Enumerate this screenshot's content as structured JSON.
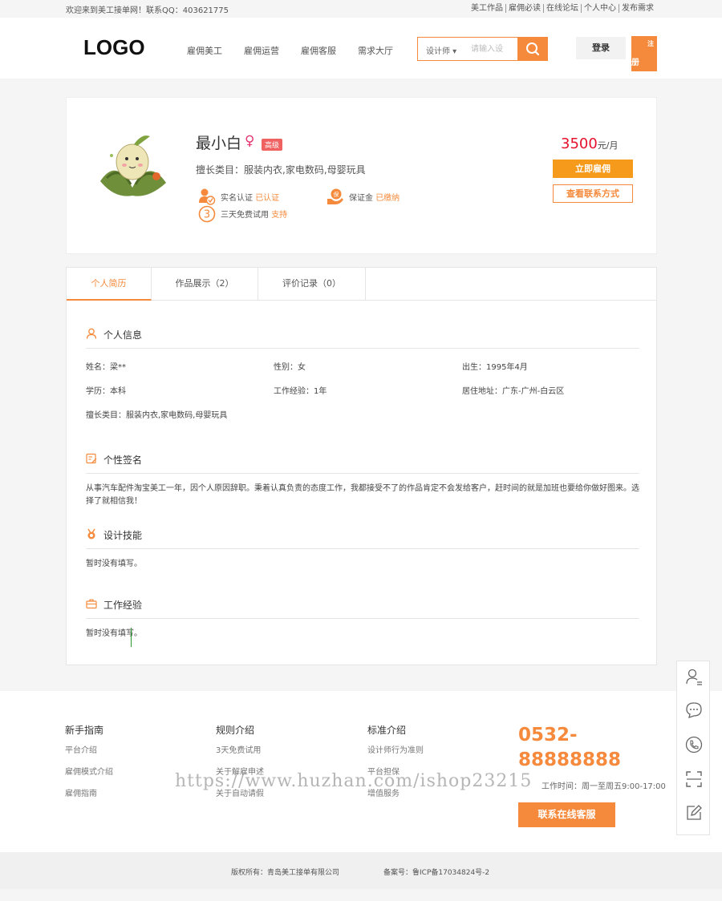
{
  "topbar": {
    "welcome": "欢迎来到美工接单网！联系QQ：403621775",
    "links": [
      "美工作品",
      "雇佣必读",
      "在线论坛",
      "个人中心",
      "发布需求"
    ]
  },
  "header": {
    "logo": "LOGO",
    "nav": [
      "雇佣美工",
      "雇佣运营",
      "雇佣客服",
      "需求大厅"
    ],
    "search_type": "设计师 ▾",
    "search_placeholder": "请输入设",
    "login": "登录",
    "register_top": "注",
    "register_bottom": "册"
  },
  "profile": {
    "name": "最小白",
    "gender_symbol": "♀",
    "level": "高级",
    "good_at": "擅长类目：服装内衣,家电数码,母婴玩具",
    "realname_label": "实名认证",
    "realname_status": "已认证",
    "deposit_label": "保证金",
    "deposit_status": "已缴纳",
    "trial_label": "三天免费试用",
    "trial_status": "支持",
    "price": "3500",
    "price_unit": "元/月",
    "hire_button": "立即雇佣",
    "contact_button": "查看联系方式"
  },
  "tabs": [
    "个人简历",
    "作品展示（2）",
    "评价记录（0）"
  ],
  "sections": {
    "info_title": "个人信息",
    "fields": {
      "name": "姓名：梁**",
      "gender": "性别：女",
      "birth": "出生：1995年4月",
      "education": "学历：本科",
      "experience": "工作经验：1年",
      "address": "居住地址：广东-广州-白云区",
      "category": "擅长类目：服装内衣,家电数码,母婴玩具"
    },
    "signature_title": "个性签名",
    "signature_text": "从事汽车配件淘宝美工一年，因个人原因辞职。秉着认真负责的态度工作，我都接受不了的作品肯定不会发给客户，赶时间的就是加班也要给你做好图来。选择了就相信我！",
    "skills_title": "设计技能",
    "skills_text": "暂时没有填写。",
    "work_title": "工作经验",
    "work_text": "暂时没有填写。"
  },
  "footer": {
    "col1_title": "新手指南",
    "col1_items": [
      "平台介绍",
      "雇佣模式介绍",
      "雇佣指南"
    ],
    "col2_title": "规则介绍",
    "col2_items": [
      "3天免费试用",
      "关于解雇申述",
      "关于自动请假"
    ],
    "col3_title": "标准介绍",
    "col3_items": [
      "设计师行为准则",
      "平台担保",
      "增值服务"
    ],
    "phone": "0532-88888888",
    "hours": "工作时间：周一至周五9:00-17:00",
    "service_button": "联系在线客服",
    "watermark": "https://www.huzhan.com/ishop23215",
    "copyright": "版权所有：青岛美工接单有限公司",
    "icp": "备案号：鲁ICP备17034824号-2"
  },
  "colors": {
    "accent": "#f58a3c",
    "price": "#e5122e",
    "level_badge": "#f06262"
  }
}
